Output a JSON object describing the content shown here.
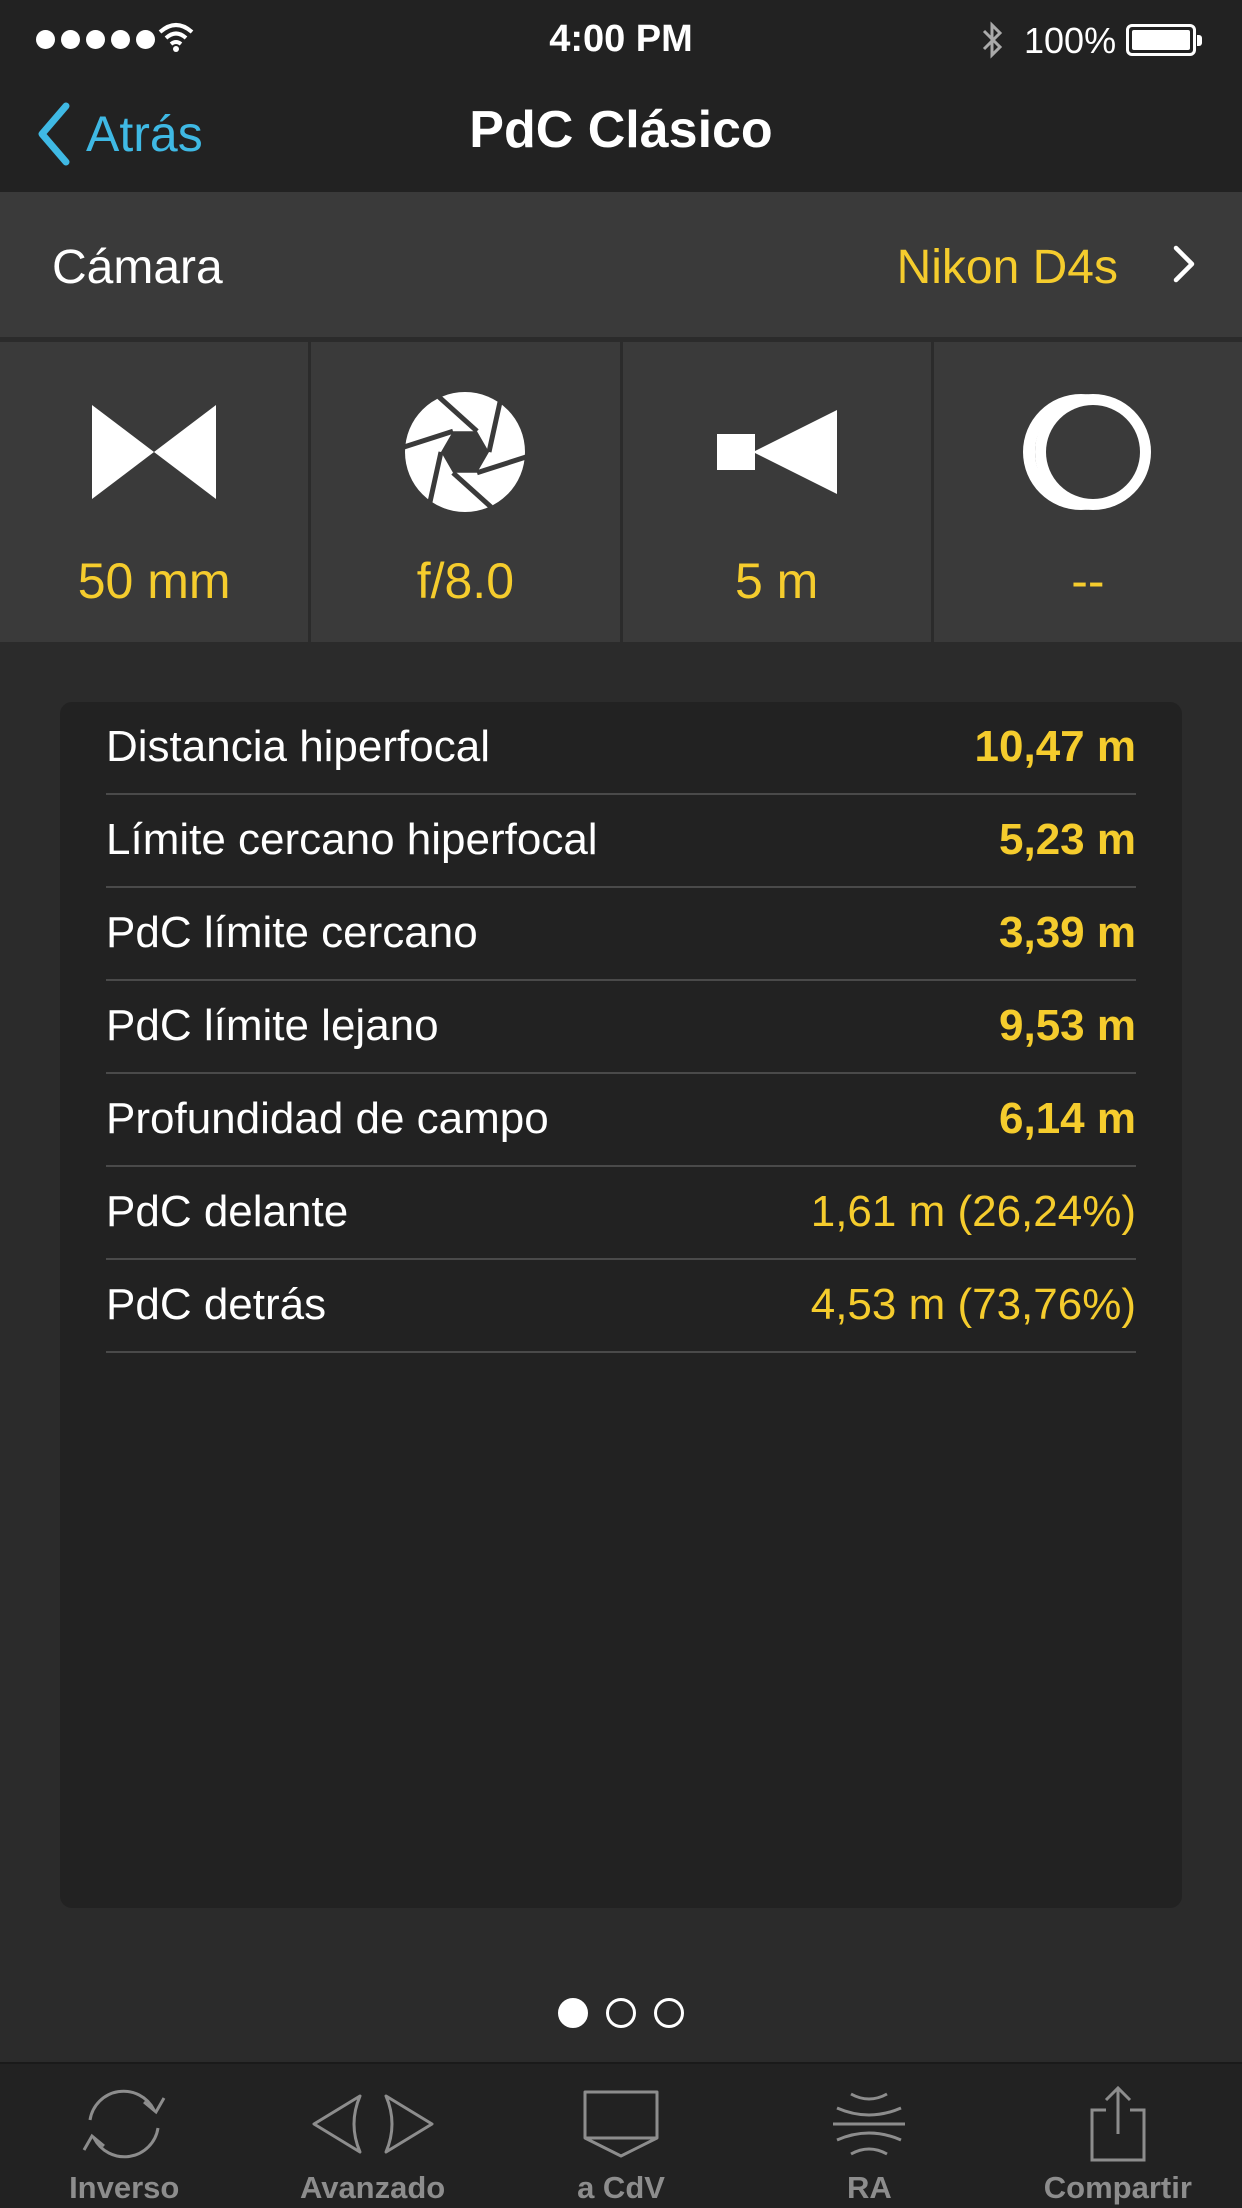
{
  "status_bar": {
    "time": "4:00 PM",
    "battery": "100%"
  },
  "nav": {
    "back_label": "Atrás",
    "title": "PdC Clásico"
  },
  "camera": {
    "label": "Cámara",
    "value": "Nikon D4s"
  },
  "settings": [
    {
      "icon": "focal-length-icon",
      "value": "50 mm"
    },
    {
      "icon": "aperture-icon",
      "value": "f/8.0"
    },
    {
      "icon": "focus-distance-icon",
      "value": "5 m"
    },
    {
      "icon": "teleconverter-icon",
      "value": "--"
    }
  ],
  "results": [
    {
      "label": "Distancia hiperfocal",
      "value": "10,47 m",
      "bold": true
    },
    {
      "label": "Límite cercano hiperfocal",
      "value": "5,23 m",
      "bold": true
    },
    {
      "label": "PdC límite cercano",
      "value": "3,39 m",
      "bold": true
    },
    {
      "label": "PdC límite lejano",
      "value": "9,53 m",
      "bold": true
    },
    {
      "label": "Profundidad de campo",
      "value": "6,14 m",
      "bold": true
    },
    {
      "label": "PdC delante",
      "value": "1,61 m (26,24%)",
      "bold": false
    },
    {
      "label": "PdC detrás",
      "value": "4,53 m (73,76%)",
      "bold": false
    }
  ],
  "pager": {
    "count": 3,
    "active": 0
  },
  "tabs": [
    {
      "icon": "refresh-icon",
      "label": "Inverso"
    },
    {
      "icon": "advanced-icon",
      "label": "Avanzado"
    },
    {
      "icon": "fov-icon",
      "label": "a CdV"
    },
    {
      "icon": "ar-icon",
      "label": "RA"
    },
    {
      "icon": "share-icon",
      "label": "Compartir"
    }
  ],
  "colors": {
    "accent": "#f5cc2d",
    "link": "#3fb9e4",
    "background": "#2b2b2b",
    "panel": "#222222",
    "tab_label": "#8d8d8d"
  }
}
